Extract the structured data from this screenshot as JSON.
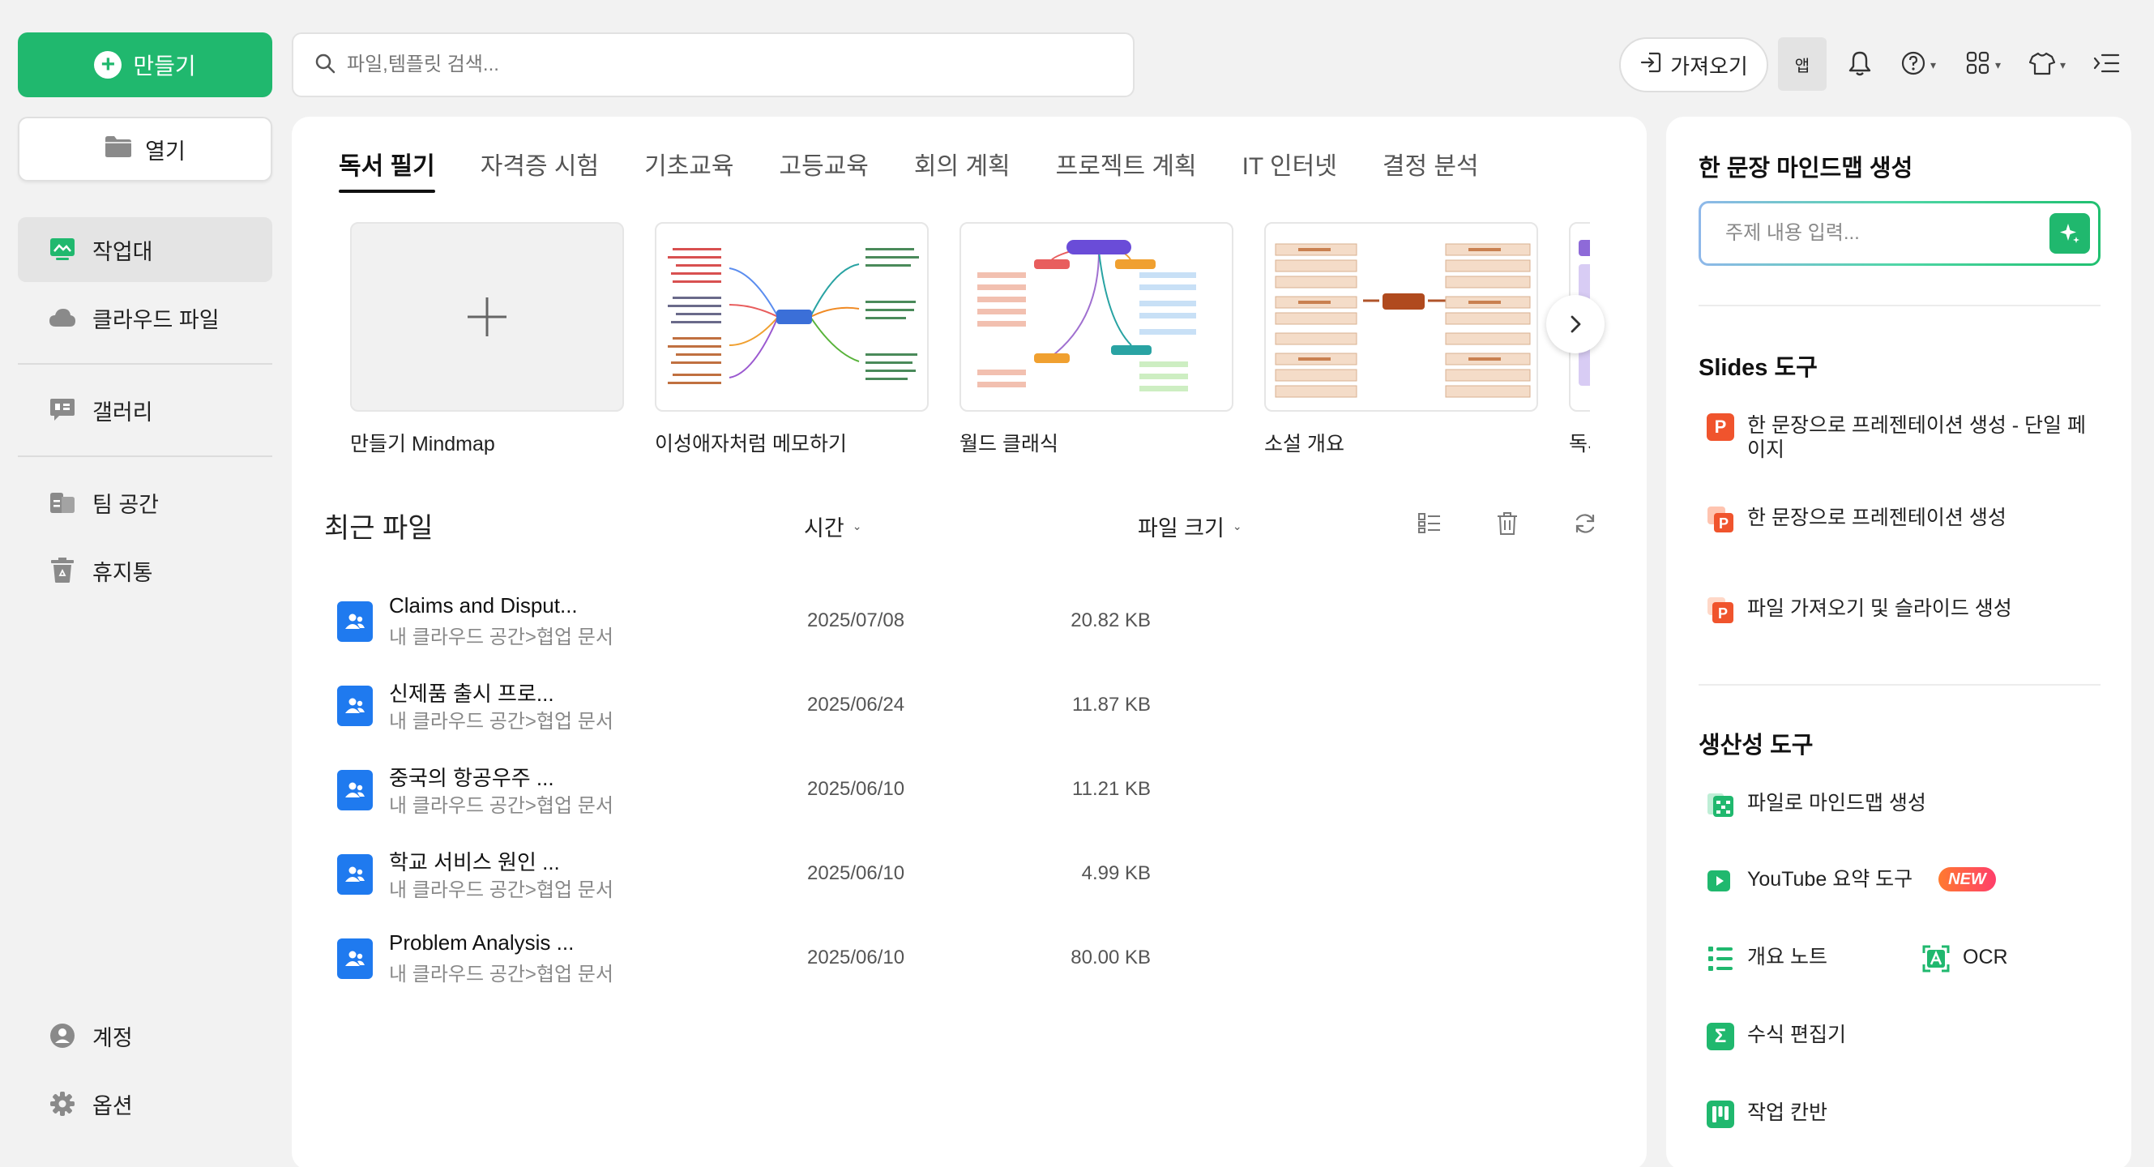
{
  "sidebar": {
    "create_label": "만들기",
    "open_label": "열기",
    "items": [
      {
        "label": "작업대"
      },
      {
        "label": "클라우드 파일"
      },
      {
        "label": "갤러리"
      },
      {
        "label": "팀 공간"
      },
      {
        "label": "휴지통"
      }
    ],
    "bottom": [
      {
        "label": "계정"
      },
      {
        "label": "옵션"
      }
    ]
  },
  "search": {
    "placeholder": "파일,템플릿 검색..."
  },
  "toolbar": {
    "import_label": "가져오기",
    "app_label": "앱"
  },
  "tabs": [
    "독서 필기",
    "자격증 시험",
    "기초교육",
    "고등교육",
    "회의 계획",
    "프로젝트 계획",
    "IT 인터넷",
    "결정 분석"
  ],
  "templates": [
    {
      "label": "만들기 Mindmap"
    },
    {
      "label": "이성애자처럼 메모하기"
    },
    {
      "label": "월드 클래식"
    },
    {
      "label": "소설 개요"
    },
    {
      "label": "독서"
    }
  ],
  "recent": {
    "title": "최근 파일",
    "col_time": "시간",
    "col_size": "파일 크기",
    "files": [
      {
        "name": "Claims and Disput...",
        "path": "내 클라우드 공간>협업 문서",
        "date": "2025/07/08",
        "size": "20.82 KB"
      },
      {
        "name": "신제품 출시 프로...",
        "path": "내 클라우드 공간>협업 문서",
        "date": "2025/06/24",
        "size": "11.87 KB"
      },
      {
        "name": "중국의 항공우주 ...",
        "path": "내 클라우드 공간>협업 문서",
        "date": "2025/06/10",
        "size": "11.21 KB"
      },
      {
        "name": "학교 서비스 원인 ...",
        "path": "내 클라우드 공간>협업 문서",
        "date": "2025/06/10",
        "size": "4.99 KB"
      },
      {
        "name": "Problem Analysis ...",
        "path": "내 클라우드 공간>협업 문서",
        "date": "2025/06/10",
        "size": "80.00 KB"
      }
    ]
  },
  "right": {
    "ai_title": "한 문장 마인드맵 생성",
    "ai_placeholder": "주제 내용 입력...",
    "slides_title": "Slides 도구",
    "slides_tools": [
      "한 문장으로 프레젠테이션 생성 - 단일 페이지",
      "한 문장으로 프레젠테이션 생성",
      "파일 가져오기 및 슬라이드 생성"
    ],
    "prod_title": "생산성 도구",
    "prod_tools": {
      "file_to_mindmap": "파일로 마인드맵 생성",
      "youtube": "YouTube 요약 도구",
      "new_badge": "NEW",
      "outline": "개요 노트",
      "ocr": "OCR",
      "formula": "수식 편집기",
      "kanban": "작업 칸반"
    }
  },
  "colors": {
    "accent": "#20b86e",
    "file_icon": "#1f7aef",
    "slides_icon": "#f0542d"
  }
}
